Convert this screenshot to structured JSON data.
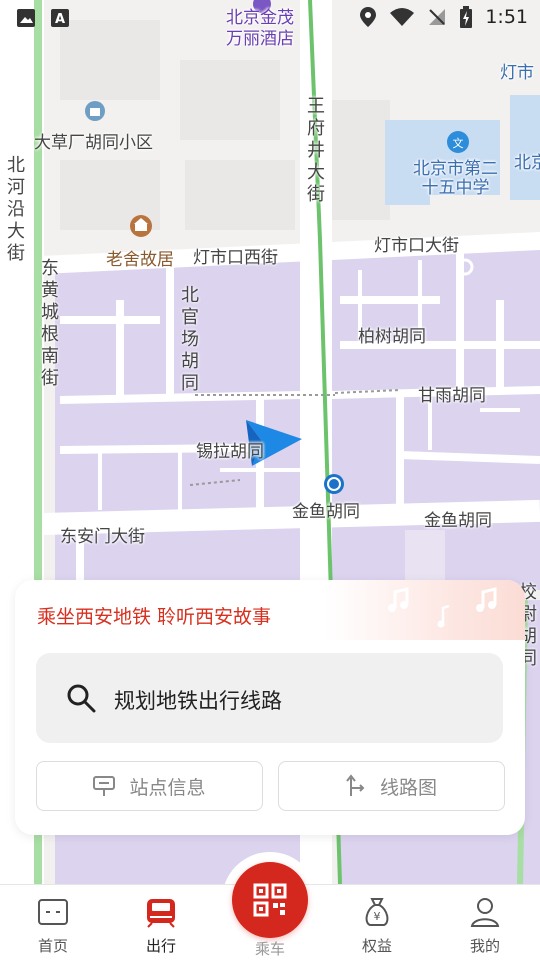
{
  "status_bar": {
    "time": "1:51"
  },
  "map": {
    "labels": {
      "poi_hotel": "北京金茂\n万丽酒店",
      "poi_lib": "灯市",
      "residential": "大草厂胡同小区",
      "road_wangfujing": "王府井大街",
      "road_beiheyan": "北河沿大街",
      "school": "北京市第二\n十五中学",
      "school_right": "北京",
      "laoshe": "老舍故居",
      "dengshikou_w": "灯市口西街",
      "dengshikou": "灯市口大街",
      "donghuangcheng": "东黄城根南街",
      "beiguanchang": "北官场胡同",
      "baishu": "柏树胡同",
      "ganyu": "甘雨胡同",
      "xila": "锡拉胡同",
      "jinyu_station": "金鱼胡同",
      "jinyu": "金鱼胡同",
      "donganmen": "东安门大街",
      "jiaowei": "校尉胡同"
    },
    "icons": [
      "location-arrow-icon",
      "metro-station-icon",
      "museum-poi-icon",
      "school-poi-icon",
      "residential-poi-icon"
    ]
  },
  "card": {
    "slogan": "乘坐西安地铁 聆听西安故事",
    "search_text": "规划地铁出行线路",
    "station_info": "站点信息",
    "line_map": "线路图"
  },
  "tabbar": {
    "home": "首页",
    "travel": "出行",
    "ride": "乘车",
    "benefits": "权益",
    "mine": "我的"
  },
  "colors": {
    "accent_red": "#d4271e",
    "map_purple": "#dcd3ef",
    "metro_green": "#6cc36c",
    "arrow_blue": "#1e88e5"
  }
}
